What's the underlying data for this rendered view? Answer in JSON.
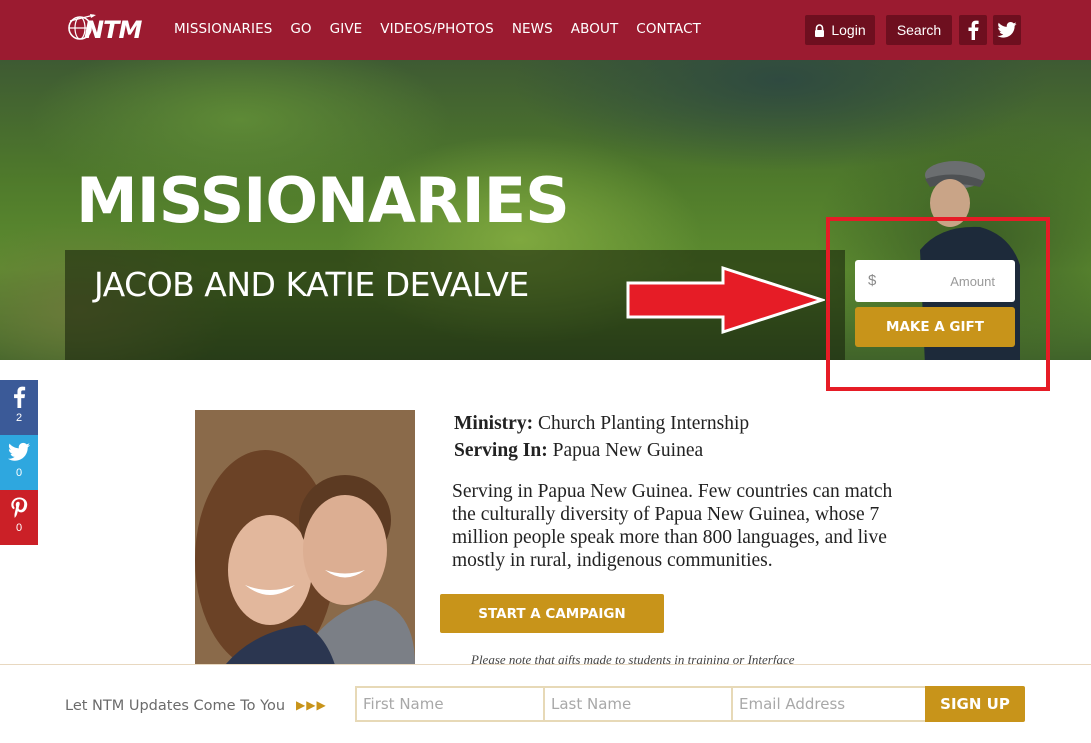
{
  "header": {
    "logo_text": "NTM",
    "nav": [
      "MISSIONARIES",
      "GO",
      "GIVE",
      "VIDEOS/PHOTOS",
      "NEWS",
      "ABOUT",
      "CONTACT"
    ],
    "login_label": "Login",
    "search_label": "Search",
    "facebook_icon": "facebook-icon",
    "twitter_icon": "twitter-icon"
  },
  "hero": {
    "title": "MISSIONARIES",
    "name": "JACOB AND KATIE DEVALVE",
    "amount_symbol": "$",
    "amount_placeholder": "Amount",
    "gift_button": "MAKE A GIFT"
  },
  "share": {
    "facebook_count": "2",
    "twitter_count": "0",
    "pinterest_count": "0"
  },
  "info": {
    "ministry_label": "Ministry:",
    "ministry_value": "Church Planting Internship",
    "serving_label": "Serving In:",
    "serving_value": "Papua New Guinea",
    "description": "Serving in Papua New Guinea. Few countries can match the culturally diversity of Papua New Guinea, whose 7 million people speak more than 800 languages, and live mostly in rural, indigenous communities.",
    "campaign_button": "START A CAMPAIGN",
    "note": "Please note that gifts made to students in training or Interface"
  },
  "footer": {
    "label": "Let NTM Updates Come To You",
    "arrows": "▶▶▶",
    "first_name": "First Name",
    "last_name": "Last Name",
    "email": "Email Address",
    "signup": "SIGN UP"
  },
  "colors": {
    "header": "#9b1b30",
    "header_button": "#6e0f1f",
    "gold": "#c8941a",
    "highlight_red": "#e61c26"
  }
}
